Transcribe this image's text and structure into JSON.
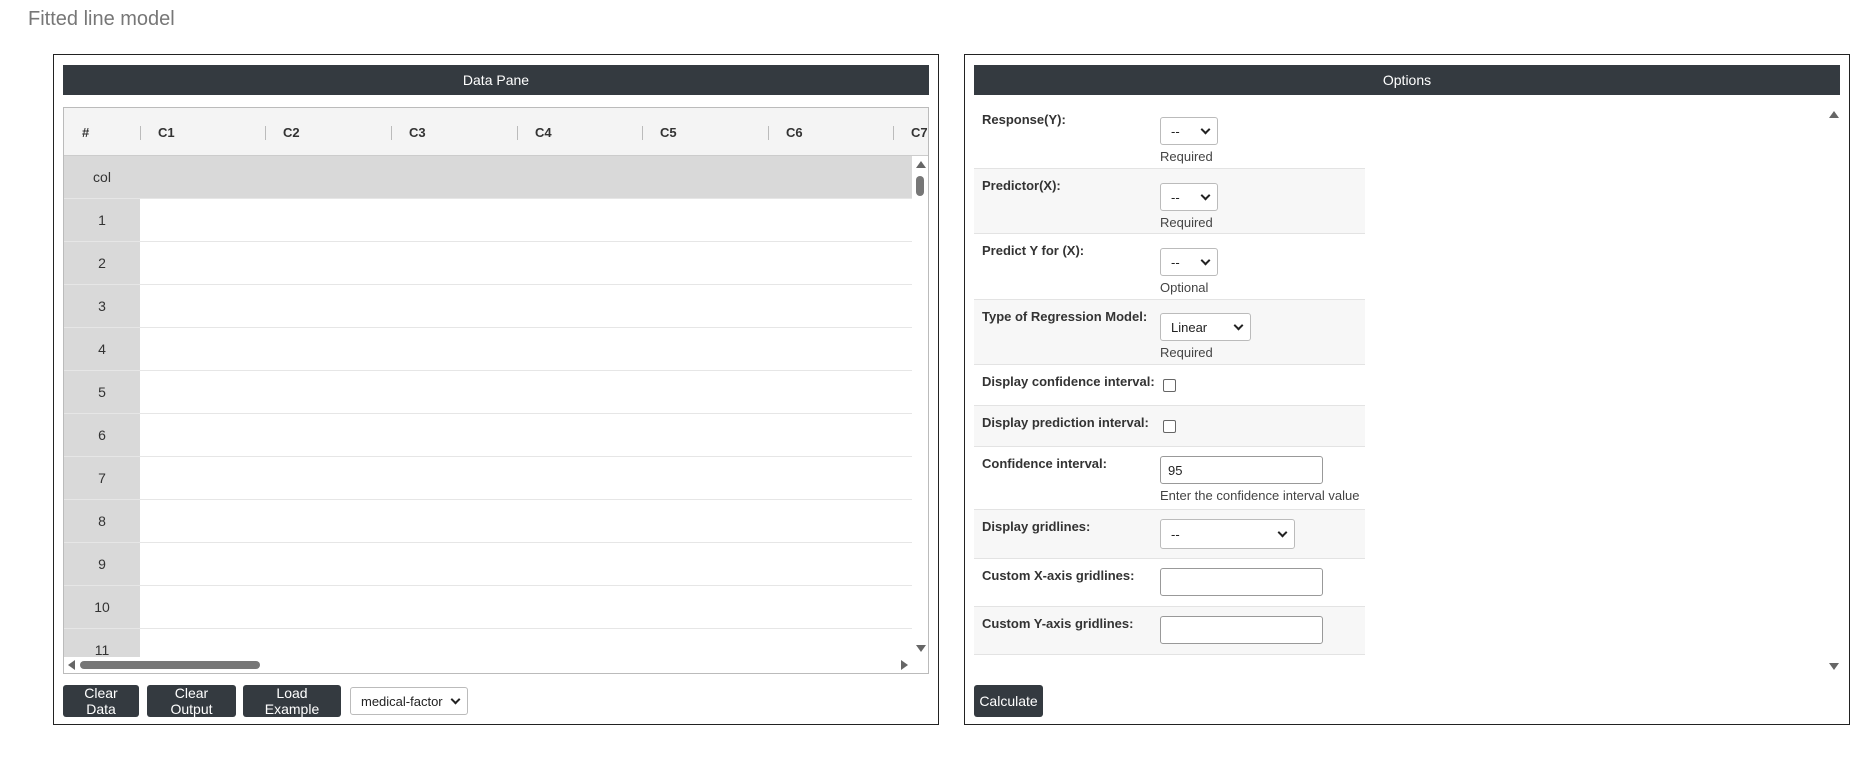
{
  "page": {
    "title": "Fitted line model"
  },
  "data_pane": {
    "header": "Data Pane",
    "columns": [
      "#",
      "C1",
      "C2",
      "C3",
      "C4",
      "C5",
      "C6",
      "C7"
    ],
    "rows": [
      "col",
      "1",
      "2",
      "3",
      "4",
      "5",
      "6",
      "7",
      "8",
      "9",
      "10",
      "11"
    ],
    "buttons": {
      "clear_data": "Clear Data",
      "clear_output": "Clear Output",
      "load_example": "Load Example"
    },
    "example_select": {
      "selected": "medical-factor"
    }
  },
  "options": {
    "header": "Options",
    "response": {
      "label": "Response(Y):",
      "value": "--",
      "hint": "Required"
    },
    "predictor": {
      "label": "Predictor(X):",
      "value": "--",
      "hint": "Required"
    },
    "predict_y": {
      "label": "Predict Y for (X):",
      "value": "--",
      "hint": "Optional"
    },
    "model_type": {
      "label": "Type of Regression Model:",
      "value": "Linear",
      "hint": "Required"
    },
    "display_ci": {
      "label": "Display confidence interval:"
    },
    "display_pi": {
      "label": "Display prediction interval:"
    },
    "confidence": {
      "label": "Confidence interval:",
      "value": "95",
      "hint": "Enter the confidence interval value"
    },
    "gridlines": {
      "label": "Display gridlines:",
      "value": "--"
    },
    "custom_x": {
      "label": "Custom X-axis gridlines:",
      "value": ""
    },
    "custom_y": {
      "label": "Custom Y-axis gridlines:",
      "value": ""
    },
    "calculate": "Calculate"
  }
}
